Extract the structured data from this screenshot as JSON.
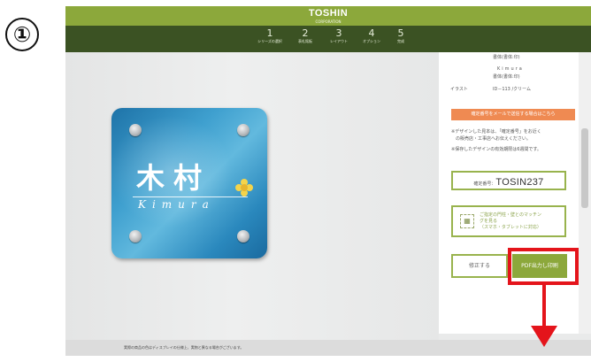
{
  "step_marker": "①",
  "header": {
    "brand": "TOSHIN",
    "brand_sub": "CORPORATION",
    "steps": [
      {
        "num": "1",
        "label": "シリーズの選択"
      },
      {
        "num": "2",
        "label": "表札銘板"
      },
      {
        "num": "3",
        "label": "レイアウト"
      },
      {
        "num": "4",
        "label": "オプション"
      },
      {
        "num": "5",
        "label": "完成"
      }
    ]
  },
  "preview": {
    "kanji": "木村",
    "romaji": "Kimura"
  },
  "panel": {
    "lines": [
      {
        "label": "",
        "value": "書体(書体:印)"
      },
      {
        "label": "",
        "value": "Kimura"
      },
      {
        "label": "",
        "value": "書体(書体:印)"
      },
      {
        "label": "イラスト",
        "value": "ID－113 /クリーム"
      }
    ],
    "mail_button": "確定番号をメールで送信する場合はこちら",
    "notes": [
      "※デザインした見本は、「確定番号」をお近く",
      "　の販売店・工事店へお伝えください。",
      "※保存したデザインの有効期限は6週間です。"
    ],
    "code_label": "確定番号：",
    "code_value": "TOSIN237",
    "qr_text": [
      "ご指定の門柱・壁とのマッチン",
      "グを見る",
      "（スマホ・タブレットに対応）"
    ],
    "fix_button": "修正する",
    "pdf_button": "PDF出力し印刷"
  },
  "footer": {
    "disclaimer": "実際の商品の色はディスプレイの仕様上、実物と異なる場合がございます。"
  },
  "colors": {
    "header_green": "#8ca83b",
    "steps_dark": "#3b5223",
    "accent_orange": "#ef8a52",
    "highlight_red": "#e4141b"
  }
}
